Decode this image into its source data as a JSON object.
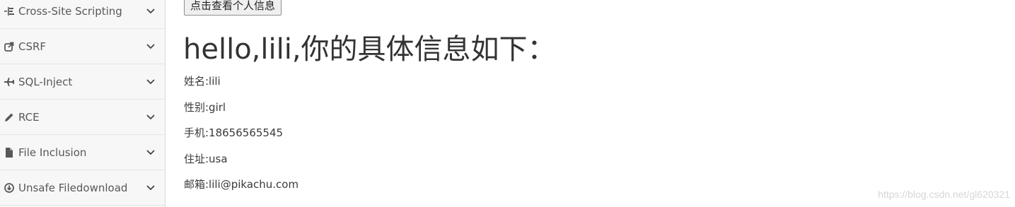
{
  "sidebar": {
    "items": [
      {
        "label": "Cross-Site Scripting",
        "icon": "list-tree-icon"
      },
      {
        "label": "CSRF",
        "icon": "share-square-icon"
      },
      {
        "label": "SQL-Inject",
        "icon": "plane-icon"
      },
      {
        "label": "RCE",
        "icon": "pencil-icon"
      },
      {
        "label": "File Inclusion",
        "icon": "file-icon"
      },
      {
        "label": "Unsafe Filedownload",
        "icon": "download-circle-icon"
      }
    ]
  },
  "main": {
    "button_label": "点击查看个人信息",
    "title": "hello,lili,你的具体信息如下：",
    "info": [
      "姓名:lili",
      "性别:girl",
      "手机:18656565545",
      "住址:usa",
      "邮箱:lili@pikachu.com"
    ]
  },
  "watermark": "https://blog.csdn.net/gl620321"
}
